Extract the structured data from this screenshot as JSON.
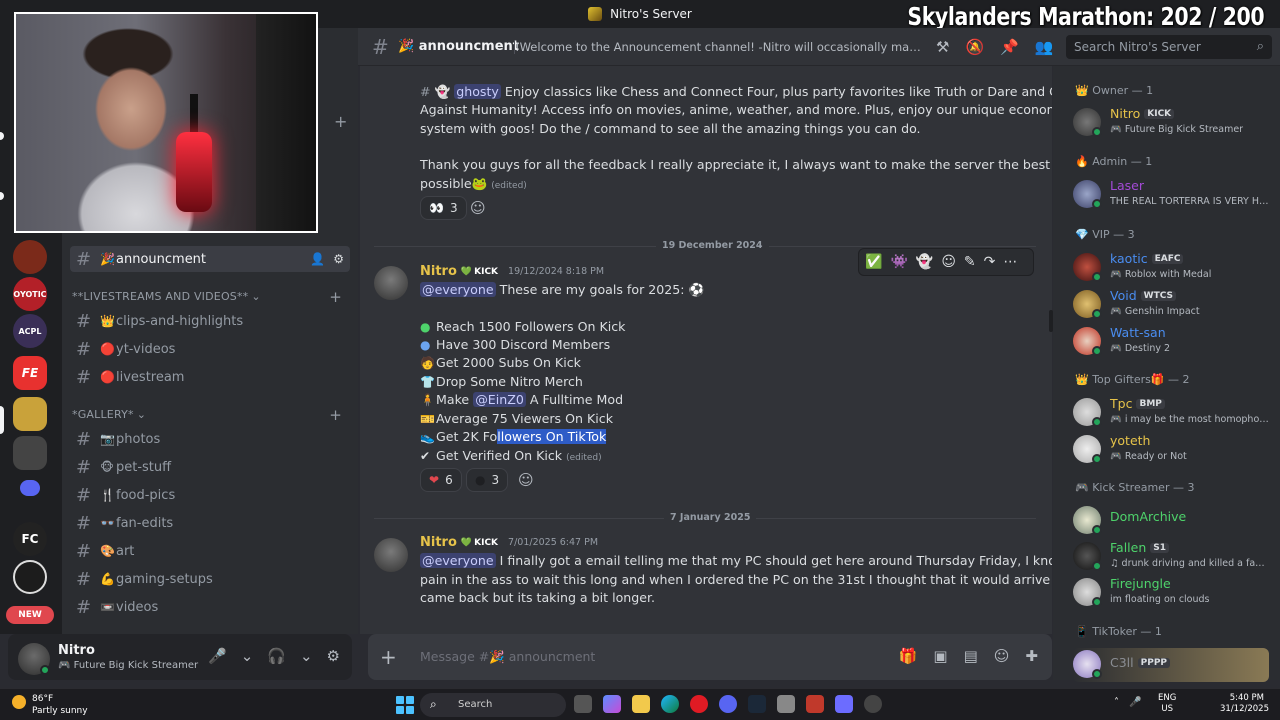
{
  "window": {
    "server_title": "Nitro's Server",
    "overlay_title": "Skylanders Marathon:  202 / 200"
  },
  "rail": {
    "new_badge": "NEW",
    "servers": [
      {
        "label": "",
        "color": "#7b2a1a"
      },
      {
        "label": "OYOTIC",
        "color": "#b32028"
      },
      {
        "label": "ACPL",
        "color": "#3a2f57"
      },
      {
        "label": "FE",
        "color": "#e8312f"
      },
      {
        "label": "",
        "color": "#c9a23a"
      },
      {
        "label": "",
        "color": "#444"
      },
      {
        "label": "",
        "color": "#5865f2"
      },
      {
        "label": "FC",
        "color": "#222"
      },
      {
        "label": "",
        "color": "#1c1c1c"
      }
    ]
  },
  "channels": {
    "active": {
      "emoji": "🎉",
      "name": "announcment"
    },
    "cat_livestreams": "**LIVESTREAMS AND VIDEOS**",
    "cat_gallery": "*GALLERY*",
    "items_live": [
      {
        "emoji": "👑",
        "name": "clips-and-highlights"
      },
      {
        "emoji": "🔴",
        "name": "yt-videos"
      },
      {
        "emoji": "🔴",
        "name": "livestream"
      }
    ],
    "items_gallery": [
      {
        "emoji": "📷",
        "name": "photos"
      },
      {
        "emoji": "🐵",
        "name": "pet-stuff"
      },
      {
        "emoji": "🍴",
        "name": "food-pics"
      },
      {
        "emoji": "👓",
        "name": "fan-edits"
      },
      {
        "emoji": "🎨",
        "name": "art"
      },
      {
        "emoji": "💪",
        "name": "gaming-setups"
      },
      {
        "emoji": "📼",
        "name": "videos"
      }
    ]
  },
  "user": {
    "name": "Nitro",
    "status": "Future Big Kick Streamer"
  },
  "header": {
    "channel": "announcment",
    "topic": "!Welcome to the Announcement channel! -Nitro will occasionally make announc...",
    "search_placeholder": "Search Nitro's Server"
  },
  "messages": {
    "m0": {
      "line1": "Enjoy classics like Chess and Connect Four, plus party favorites like Truth or Dare and Cards",
      "mention": "ghosty",
      "line2": "Against Humanity! Access info on movies, anime, weather, and more. Plus, enjoy our unique economy",
      "line3": "system with goos! Do the / command to see all the amazing things you can do.",
      "line4": "Thank you guys for all the feedback I really appreciate it, I always want to make the server the best as",
      "line5": "possible",
      "edited": "(edited)",
      "reaction_count": "3"
    },
    "divider1": "19 December 2024",
    "m1": {
      "author": "Nitro",
      "badge": "KICK",
      "timestamp": "19/12/2024 8:18 PM",
      "mention": "@everyone",
      "intro": "These are my goals for 2025:",
      "goals": [
        "Reach 1500 Followers On Kick",
        "Have 300 Discord Members",
        "Get 2000 Subs On Kick",
        "Drop Some Nitro Merch",
        "A Fulltime Mod",
        "Average 75 Viewers On Kick",
        "Get 2K Fo",
        "llowers On TikTok",
        "Get Verified On Kick"
      ],
      "make_word": "Make",
      "mod_mention": "@EinZ0",
      "edited": "(edited)",
      "react_heart": "6",
      "react_other": "3"
    },
    "divider2": "7 January 2025",
    "m2": {
      "author": "Nitro",
      "badge": "KICK",
      "timestamp": "7/01/2025 6:47 PM",
      "mention": "@everyone",
      "line1": "I finally got a email telling me that my PC should get here around Thursday Friday, I know it a",
      "line2": "pain in the ass to wait this long and when I ordered the PC on the 31st I thought that it would arrive when I",
      "line3": "came back but its taking a bit longer."
    }
  },
  "composer": {
    "placeholder": "Message #🎉 announcment"
  },
  "members": {
    "owner_header": "Owner — 1",
    "admin_header": "Admin — 1",
    "vip_header": "VIP — 3",
    "gifters_header": "Top Gifters🎁 — 2",
    "kick_header": "Kick Streamer — 3",
    "tiktok_header": "TikToker — 1",
    "list": [
      {
        "name": "Nitro",
        "tag": "KICK",
        "status": "Future Big Kick Streamer",
        "color": "#e6c34a"
      },
      {
        "name": "Laser",
        "tag": "",
        "status": "THE REAL TORTERRA IS VERY HOT",
        "color": "#a34ad6"
      },
      {
        "name": "kaotic",
        "tag": "EAFC",
        "status": "Roblox with Medal",
        "color": "#4a8df0"
      },
      {
        "name": "Void",
        "tag": "WTCS",
        "status": "Genshin Impact",
        "color": "#4a8df0"
      },
      {
        "name": "Watt-san",
        "tag": "",
        "status": "Destiny 2",
        "color": "#4a8df0"
      },
      {
        "name": "Tpc",
        "tag": "BMP",
        "status": "i may be the most homophobi...",
        "color": "#e6c34a"
      },
      {
        "name": "yoteth",
        "tag": "",
        "status": "Ready or Not",
        "color": "#e6c34a"
      },
      {
        "name": "DomArchive",
        "tag": "",
        "status": "",
        "color": "#4ed36b"
      },
      {
        "name": "Fallen",
        "tag": "S1",
        "status": "drunk driving and killed a fami...",
        "color": "#4ed36b"
      },
      {
        "name": "Firejungle",
        "tag": "",
        "status": "im floating on clouds",
        "color": "#4ed36b"
      },
      {
        "name": "C3ll",
        "tag": "PPPP",
        "status": "",
        "color": "#8a8d93"
      }
    ]
  },
  "taskbar": {
    "temp": "86°F",
    "weather": "Partly sunny",
    "search": "Search",
    "lang1": "ENG",
    "lang2": "US",
    "time": "5:40 PM",
    "date": "31/12/2025"
  }
}
